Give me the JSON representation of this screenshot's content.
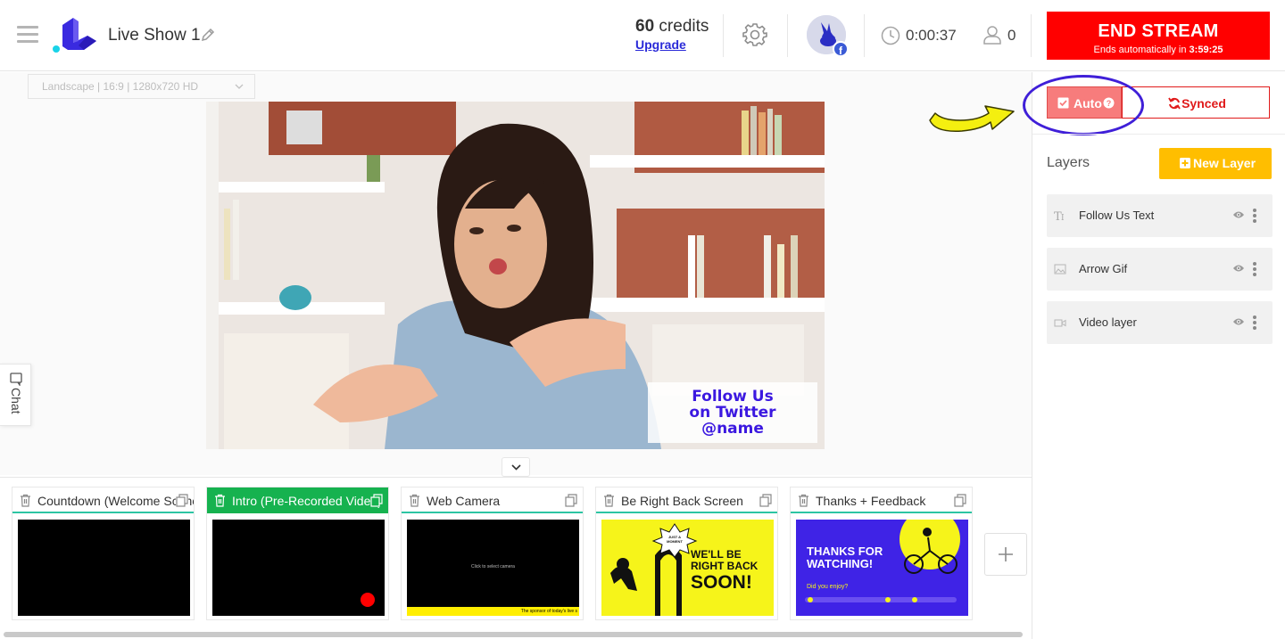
{
  "header": {
    "show_title": "Live Show 1",
    "credits_value": "60",
    "credits_label": "credits",
    "upgrade_label": "Upgrade",
    "timer": "0:00:37",
    "viewer_count": "0",
    "end_stream_label": "END STREAM",
    "end_stream_sub": "Ends automatically in",
    "end_stream_remaining": "3:59:25",
    "icons": [
      "menu-icon",
      "logo",
      "pencil-icon",
      "gear-icon",
      "avatar",
      "facebook-badge",
      "clock-icon",
      "user-icon"
    ]
  },
  "stage": {
    "resolution": "Landscape | 16:9 | 1280x720 HD",
    "overlay_lines": [
      "Follow Us",
      "on Twitter",
      "@name"
    ],
    "chat_tab": "Chat"
  },
  "scenes": [
    {
      "name": "Countdown (Welcome Scene)",
      "active": false
    },
    {
      "name": "Intro (Pre-Recorded Video)",
      "active": true
    },
    {
      "name": "Web Camera",
      "active": false,
      "thumb_hint": "Click to select camera",
      "thumb_ticker": "The sponsor of today's live s"
    },
    {
      "name": "Be Right Back Screen",
      "active": false,
      "thumb_lines": [
        "WE'LL BE",
        "RIGHT BACK",
        "SOON!"
      ],
      "thumb_badge": "JUST A MOMENT"
    },
    {
      "name": "Thanks + Feedback",
      "active": false,
      "thumb_lines": [
        "THANKS FOR",
        "WATCHING!"
      ],
      "thumb_question": "Did you enjoy?"
    }
  ],
  "side_panel": {
    "auto_label": "Auto",
    "synced_label": "Synced",
    "layers_title": "Layers",
    "new_layer_label": "New Layer",
    "layers": [
      {
        "name": "Follow Us Text",
        "icon": "text-icon"
      },
      {
        "name": "Arrow Gif",
        "icon": "image-icon"
      },
      {
        "name": "Video layer",
        "icon": "video-icon"
      }
    ]
  },
  "colors": {
    "end_stream": "#ff0000",
    "active_scene": "#16b24f",
    "new_layer": "#ffbe00",
    "overlay_text": "#3b18e0",
    "synced": "#e01a1a",
    "highlight": "#3f1fd8"
  }
}
